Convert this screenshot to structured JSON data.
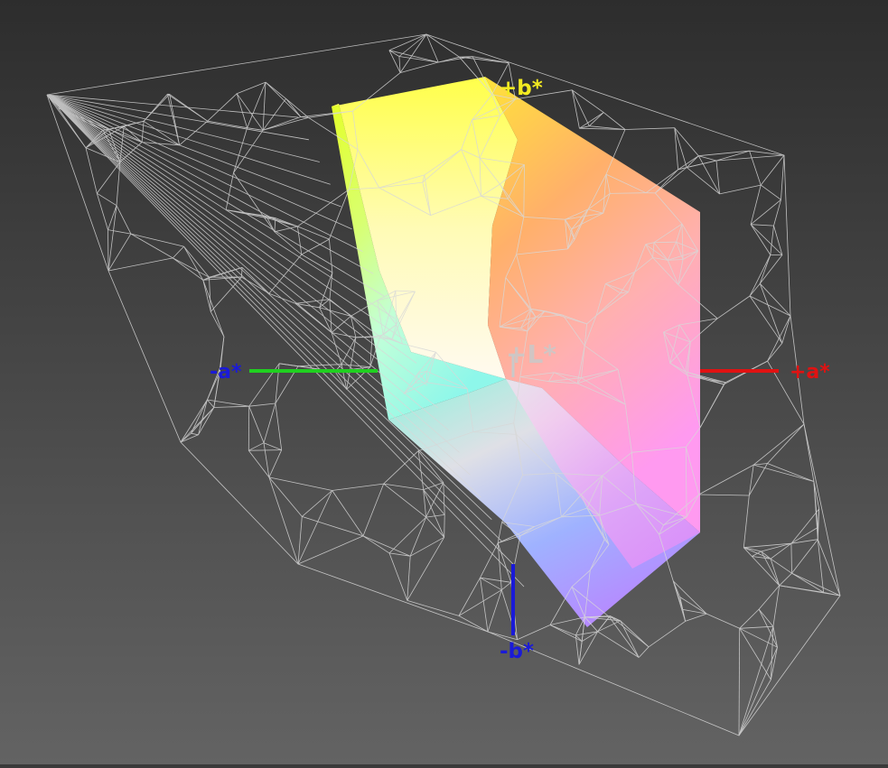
{
  "axes": {
    "plus_b": {
      "label": "+b*",
      "color": "#f2ea21"
    },
    "minus_b": {
      "label": "-b*",
      "color": "#1a1ad8"
    },
    "plus_a": {
      "label": "+a*",
      "color": "#e01212"
    },
    "minus_a": {
      "label": "-a*",
      "color": "#1a1ad8"
    },
    "plus_L": {
      "label": "+L*",
      "color": "#c9c9c9"
    }
  },
  "colors": {
    "background_top": "#2f2f2f",
    "background_bottom": "#616161",
    "wireframe": "#d8d8d8",
    "minus_a_line": "#20d020",
    "plus_a_line": "#e01212",
    "minus_b_line": "#1a1ad8"
  }
}
